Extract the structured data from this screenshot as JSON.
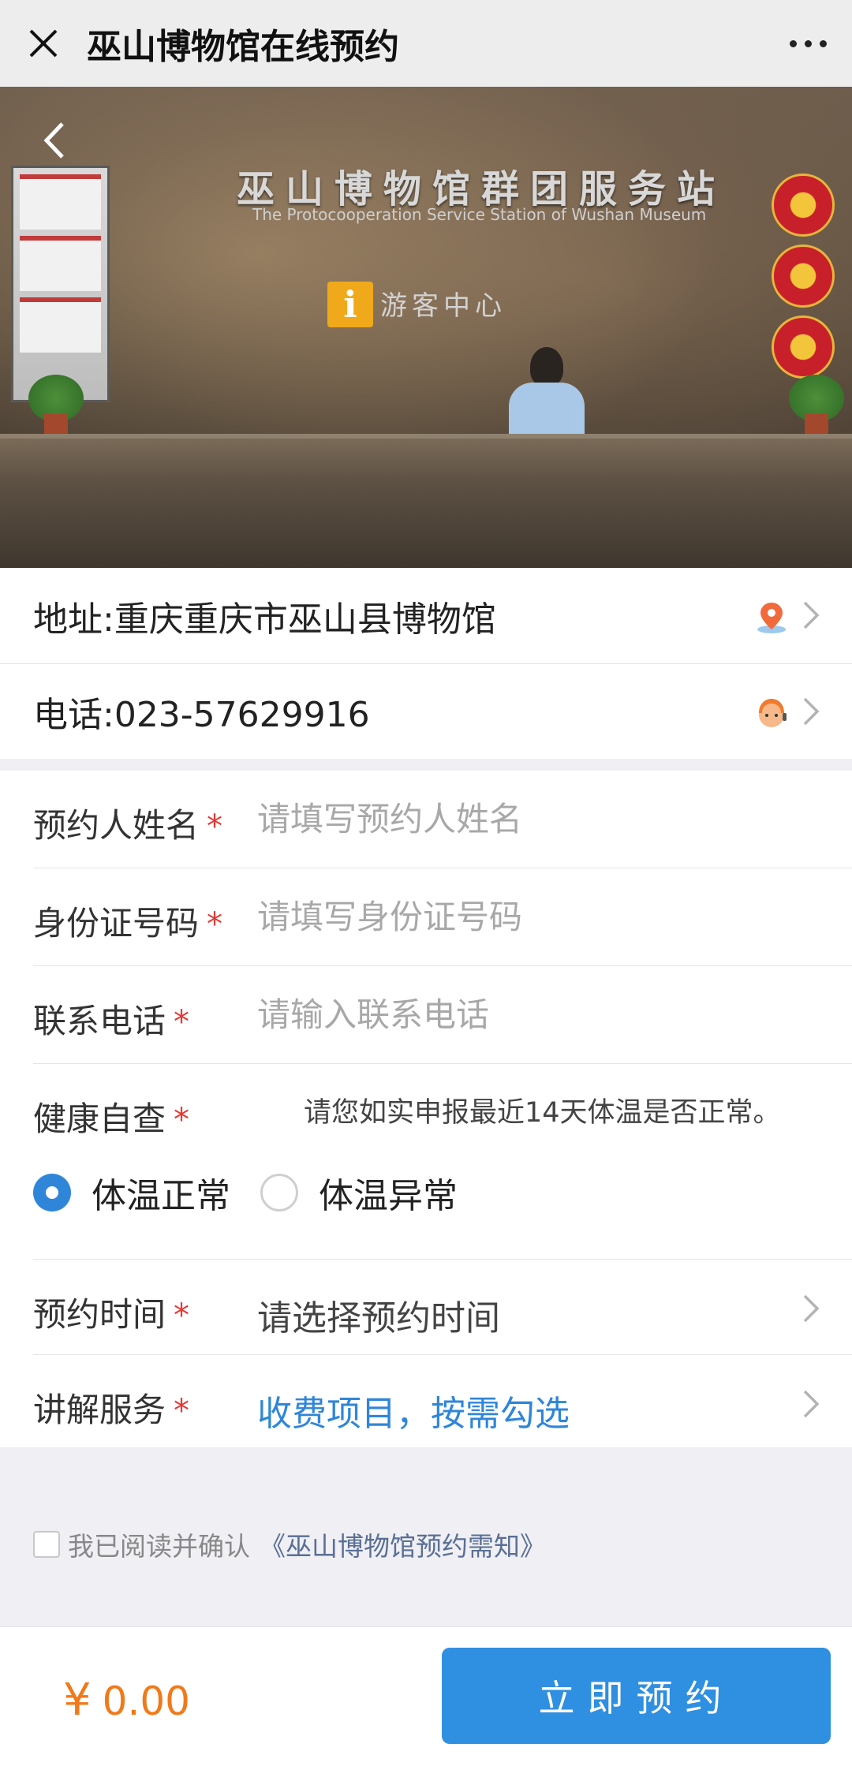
{
  "header": {
    "title": "巫山博物馆在线预约",
    "close_icon": "close-icon",
    "more_icon": "more-dots-icon"
  },
  "hero": {
    "wall_text": "巫山博物馆群团服务站",
    "wall_subtext": "The Protocooperation Service Station of Wushan Museum",
    "sign_letter": "i",
    "center_text": "游客中心",
    "back_icon": "chevron-left-icon"
  },
  "info": {
    "address": "地址:重庆重庆市巫山县博物馆",
    "phone": "电话:023-57629916",
    "address_icon": "location-pin-icon",
    "phone_icon": "customer-service-icon"
  },
  "form": {
    "name": {
      "label": "预约人姓名",
      "required": "*",
      "placeholder": "请填写预约人姓名"
    },
    "id_number": {
      "label": "身份证号码",
      "required": "*",
      "placeholder": "请填写身份证号码"
    },
    "contact": {
      "label": "联系电话",
      "required": "*",
      "placeholder": "请输入联系电话"
    },
    "health": {
      "label": "健康自查",
      "required": "*",
      "note": "请您如实申报最近14天体温是否正常。",
      "options": [
        "体温正常",
        "体温异常"
      ],
      "selected": "体温正常"
    },
    "time": {
      "label": "预约时间",
      "required": "*",
      "value": "请选择预约时间"
    },
    "guide": {
      "label": "讲解服务",
      "required": "*",
      "value": "收费项目，按需勾选"
    }
  },
  "agreement": {
    "text": "我已阅读并确认",
    "link": "《巫山博物馆预约需知》",
    "checked": false
  },
  "footer": {
    "currency": "¥",
    "amount": "0.00",
    "submit_label": "立即预约"
  },
  "colors": {
    "accent": "#2f8fe0",
    "price": "#f07a1a",
    "required_star": "#e53935",
    "link": "#2f86d9"
  }
}
